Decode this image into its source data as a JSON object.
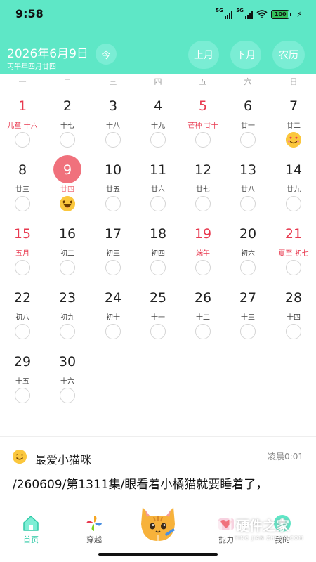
{
  "status_bar": {
    "time": "9:58",
    "network_1": "5G",
    "network_2": "5G",
    "battery": "100"
  },
  "header": {
    "title": "2026年6月9日",
    "subtitle": "丙午年四月廿四",
    "today_label": "今",
    "prev_label": "上月",
    "next_label": "下月",
    "lunar_label": "农历",
    "color": "#5ee7c6"
  },
  "weekdays": [
    "一",
    "二",
    "三",
    "四",
    "五",
    "六",
    "日"
  ],
  "days": [
    {
      "day": "1",
      "lunar": "儿童 十六",
      "red": true
    },
    {
      "day": "2",
      "lunar": "十七"
    },
    {
      "day": "3",
      "lunar": "十八"
    },
    {
      "day": "4",
      "lunar": "十九"
    },
    {
      "day": "5",
      "lunar": "芒种 廿十",
      "red": true
    },
    {
      "day": "6",
      "lunar": "廿一"
    },
    {
      "day": "7",
      "lunar": "廿二",
      "mood": "love-face-emoji"
    },
    {
      "day": "8",
      "lunar": "廿三"
    },
    {
      "day": "9",
      "lunar": "廿四",
      "selected": true,
      "mood": "laughing-face-emoji"
    },
    {
      "day": "10",
      "lunar": "廿五"
    },
    {
      "day": "11",
      "lunar": "廿六"
    },
    {
      "day": "12",
      "lunar": "廿七"
    },
    {
      "day": "13",
      "lunar": "廿八"
    },
    {
      "day": "14",
      "lunar": "廿九"
    },
    {
      "day": "15",
      "lunar": "五月",
      "red": true
    },
    {
      "day": "16",
      "lunar": "初二"
    },
    {
      "day": "17",
      "lunar": "初三"
    },
    {
      "day": "18",
      "lunar": "初四"
    },
    {
      "day": "19",
      "lunar": "端午",
      "red": true
    },
    {
      "day": "20",
      "lunar": "初六"
    },
    {
      "day": "21",
      "lunar": "夏至 初七",
      "red": true
    },
    {
      "day": "22",
      "lunar": "初八"
    },
    {
      "day": "23",
      "lunar": "初九"
    },
    {
      "day": "24",
      "lunar": "初十"
    },
    {
      "day": "25",
      "lunar": "十一"
    },
    {
      "day": "26",
      "lunar": "十二"
    },
    {
      "day": "27",
      "lunar": "十三"
    },
    {
      "day": "28",
      "lunar": "十四"
    },
    {
      "day": "29",
      "lunar": "十五"
    },
    {
      "day": "30",
      "lunar": "十六"
    }
  ],
  "diary": {
    "title": "最爱小猫咪",
    "time": "凌晨0:01",
    "text": "/260609/第1311集/眼看着小橘猫就要睡着了，"
  },
  "nav": {
    "home": "首页",
    "travel": "穿越",
    "energy": "能力",
    "mine": "我的"
  },
  "watermark": {
    "text": "硬件之家",
    "sub": "YING JIAN ZHI JIA.COM"
  }
}
